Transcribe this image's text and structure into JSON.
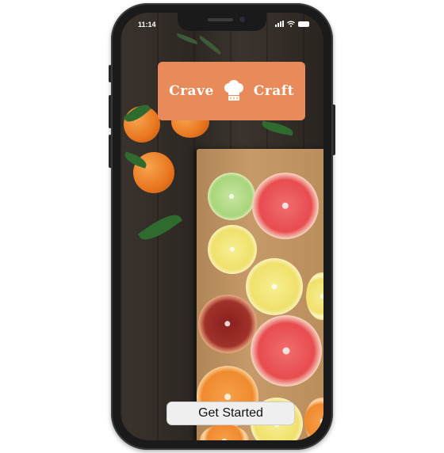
{
  "status_bar": {
    "time": "11:14"
  },
  "logo": {
    "word_left": "Crave",
    "word_right": "Craft",
    "icon": "chef-hat-icon"
  },
  "cta": {
    "label": "Get Started"
  },
  "colors": {
    "brand": "#e98a5a",
    "button_bg": "#efefef"
  }
}
